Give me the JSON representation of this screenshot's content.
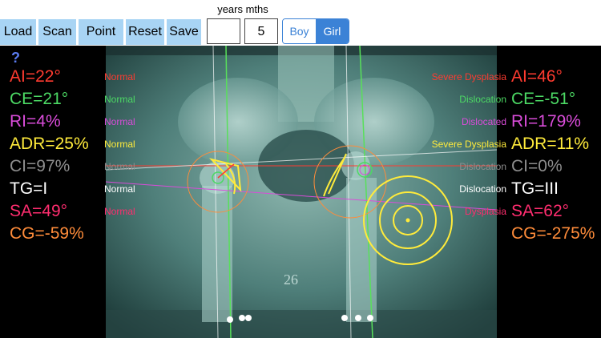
{
  "toolbar": {
    "load": "Load",
    "scan": "Scan",
    "point": "Point",
    "reset": "Reset",
    "save": "Save",
    "age_label": "years mths",
    "years_value": "",
    "months_value": "5",
    "boy": "Boy",
    "girl": "Girl",
    "selected_sex": "Girl"
  },
  "help": "?",
  "left": [
    {
      "metric": "AI=22°",
      "status": "Normal",
      "color": "#ff3b30"
    },
    {
      "metric": "CE=21°",
      "status": "Normal",
      "color": "#4cd964"
    },
    {
      "metric": "RI=4%",
      "status": "Normal",
      "color": "#d94cd9"
    },
    {
      "metric": "ADR=25%",
      "status": "Normal",
      "color": "#ffeb3b"
    },
    {
      "metric": "CI=97%",
      "status": "Normal",
      "color": "#8e8e8e"
    },
    {
      "metric": "TG=I",
      "status": "Normal",
      "color": "#ffffff"
    },
    {
      "metric": "SA=49°",
      "status": "Normal",
      "color": "#ff2d6f"
    },
    {
      "metric": "CG=-59%",
      "status": "",
      "color": "#ff8c3a"
    }
  ],
  "right": [
    {
      "metric": "AI=46°",
      "status": "Severe Dysplasia",
      "color": "#ff3b30"
    },
    {
      "metric": "CE=-51°",
      "status": "Dislocation",
      "color": "#4cd964"
    },
    {
      "metric": "RI=179%",
      "status": "Dislocated",
      "color": "#d94cd9"
    },
    {
      "metric": "ADR=11%",
      "status": "Severe Dysplasia",
      "color": "#ffeb3b"
    },
    {
      "metric": "CI=0%",
      "status": "Dislocation",
      "color": "#8e8e8e"
    },
    {
      "metric": "TG=III",
      "status": "Dislocation",
      "color": "#ffffff"
    },
    {
      "metric": "SA=62°",
      "status": "Dysplasia",
      "color": "#ff2d6f"
    },
    {
      "metric": "CG=-275%",
      "status": "",
      "color": "#ff8c3a"
    }
  ],
  "xray_annotation": "26"
}
